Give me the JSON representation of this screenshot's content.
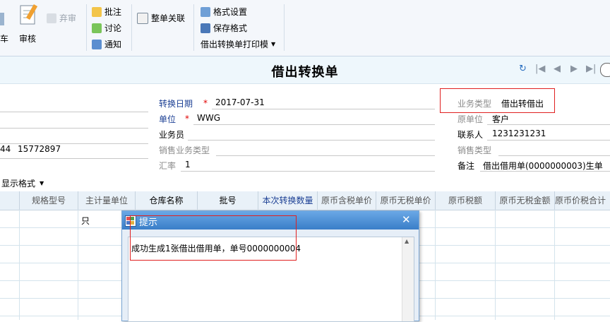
{
  "ribbon": {
    "btn_audit": "审核",
    "btn_abandon": "弃审",
    "btn_annotate": "批注",
    "btn_discuss": "讨论",
    "btn_notify": "通知",
    "btn_whole_link": "整单关联",
    "btn_format_settings": "格式设置",
    "btn_save_format": "保存格式",
    "print_template_select": "借出转换单打印模",
    "left_fragment": "车"
  },
  "title": "借出转换单",
  "header": {
    "convert_date_label": "转换日期",
    "convert_date_value": "2017-07-31",
    "unit_label": "单位",
    "unit_value": "WWG",
    "salesman_label": "业务员",
    "sales_type_label": "销售业务类型",
    "rate_label": "汇率",
    "rate_value": "1",
    "biz_type_label": "业务类型",
    "biz_type_value": "借出转借出",
    "orig_unit_label": "原单位",
    "orig_unit_value": "客户",
    "contact_label": "联系人",
    "contact_value": "1231231231",
    "sale_type_label": "销售类型",
    "remark_label": "备注",
    "remark_value": "借出借用单(0000000003)生单",
    "left_frag_1": "44",
    "left_frag_2": "15772897"
  },
  "grid": {
    "display_format": "显示格式",
    "columns": [
      "规格型号",
      "主计量单位",
      "仓库名称",
      "批号",
      "本次转换数量",
      "原币含税单价",
      "原币无税单价",
      "原币税额",
      "原币无税金额",
      "原币价税合计"
    ],
    "row1_unit": "只"
  },
  "dialog": {
    "title": "提示",
    "message": "成功生成1张借出借用单，单号0000000004"
  }
}
